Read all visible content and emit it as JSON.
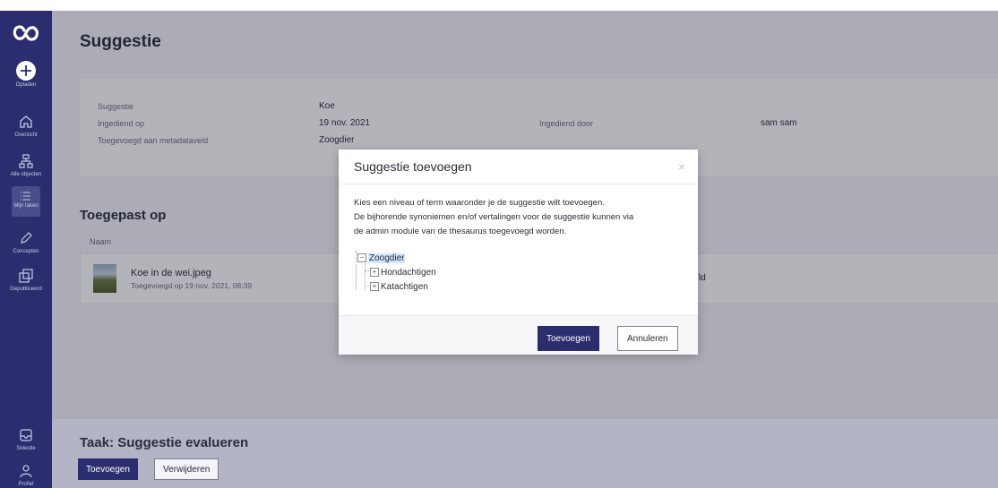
{
  "sidebar": {
    "upload_label": "Opladen",
    "items": [
      {
        "label": "Overzicht",
        "icon": "home-icon"
      },
      {
        "label": "Alle objecten",
        "icon": "hierarchy-icon"
      },
      {
        "label": "Mijn taken",
        "icon": "task-list-icon"
      },
      {
        "label": "Concepten",
        "icon": "pencil-icon"
      },
      {
        "label": "Gepubliceerd",
        "icon": "published-icon"
      }
    ],
    "bottom_items": [
      {
        "label": "Selectie",
        "icon": "tray-icon"
      },
      {
        "label": "Profiel",
        "icon": "person-icon"
      }
    ]
  },
  "page": {
    "title": "Suggestie",
    "fields": {
      "suggestie_label": "Suggestie",
      "suggestie_value": "Koe",
      "ingediend_op_label": "Ingediend op",
      "ingediend_op_value": "19 nov. 2021",
      "ingediend_door_label": "Ingediend door",
      "ingediend_door_value": "sam sam",
      "metadataveld_label": "Toegevoegd aan metadataveld",
      "metadataveld_value": "Zoogdier"
    },
    "applied_title": "Toegepast op",
    "col_name": "Naam",
    "file": {
      "name": "Koe in de wei.jpeg",
      "added": "Toegevoegd op 19 nov. 2021, 08:39",
      "right_text": "ld"
    }
  },
  "task": {
    "title": "Taak: Suggestie evalueren",
    "add_label": "Toevoegen",
    "remove_label": "Verwijderen"
  },
  "modal": {
    "title": "Suggestie toevoegen",
    "close": "×",
    "line1": "Kies een niveau of term waaronder je de suggestie wilt toevoegen.",
    "line2": "De bijhorende synoniemen en/of vertalingen voor de suggestie kunnen via",
    "line3": "de admin module van de thesaurus toegevoegd worden.",
    "tree": {
      "root": "Zoogdier",
      "children": [
        "Hondachtigen",
        "Katachtigen"
      ]
    },
    "primary_label": "Toevoegen",
    "secondary_label": "Annuleren"
  },
  "colors": {
    "sidebar_bg": "#2b2d6e",
    "primary": "#2b2d6e",
    "selection": "#cfe6fb"
  }
}
